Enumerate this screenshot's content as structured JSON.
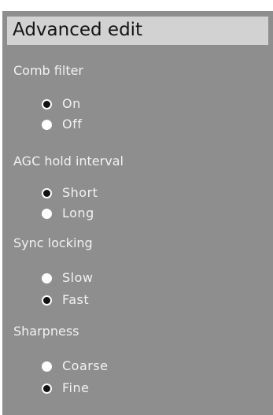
{
  "title": "Advanced edit",
  "groups": [
    {
      "label": "Comb filter",
      "options": [
        {
          "label": "On",
          "checked": true
        },
        {
          "label": "Off",
          "checked": false
        }
      ]
    },
    {
      "label": "AGC hold interval",
      "options": [
        {
          "label": "Short",
          "checked": true
        },
        {
          "label": "Long",
          "checked": false
        }
      ]
    },
    {
      "label": "Sync locking",
      "options": [
        {
          "label": "Slow",
          "checked": false
        },
        {
          "label": "Fast",
          "checked": true
        }
      ]
    },
    {
      "label": "Sharpness",
      "options": [
        {
          "label": "Coarse",
          "checked": false
        },
        {
          "label": "Fine",
          "checked": true
        }
      ]
    }
  ]
}
